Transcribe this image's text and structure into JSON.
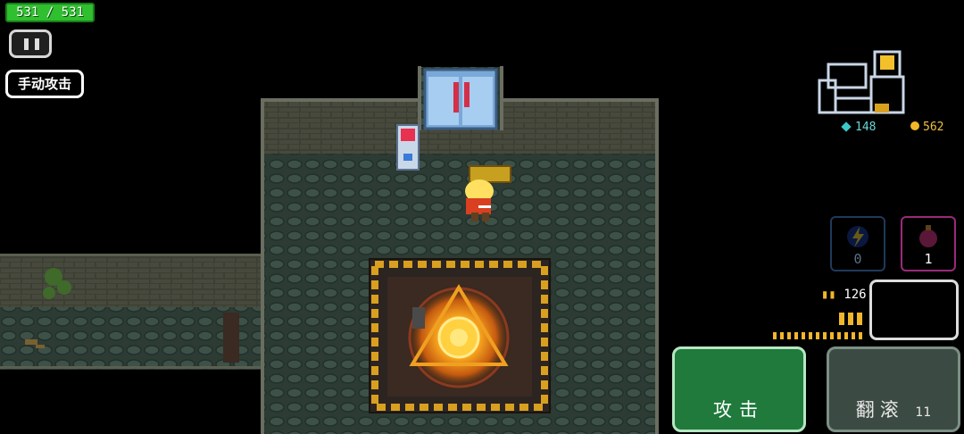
{
  "hud": {
    "hp_text": "531 / 531",
    "manual_attack_label": "手动攻击"
  },
  "currency": {
    "gems": "148",
    "coins": "562"
  },
  "skills": {
    "lightning_count": "0",
    "potion_count": "1"
  },
  "weapon": {
    "ammo": "126"
  },
  "actions": {
    "attack_label": "攻击",
    "roll_label": "翻滚",
    "roll_marker": "11"
  },
  "colors": {
    "hp_green": "#2fbf2f",
    "attack_green": "#1f7a3c",
    "roll_gray": "#3b4a42",
    "portal_orange": "#ffb020"
  },
  "icons": [
    "pause-icon",
    "gem-icon",
    "coin-icon",
    "lightning-icon",
    "potion-icon",
    "sword-icon",
    "pistol-icon",
    "character-portrait-icon"
  ]
}
